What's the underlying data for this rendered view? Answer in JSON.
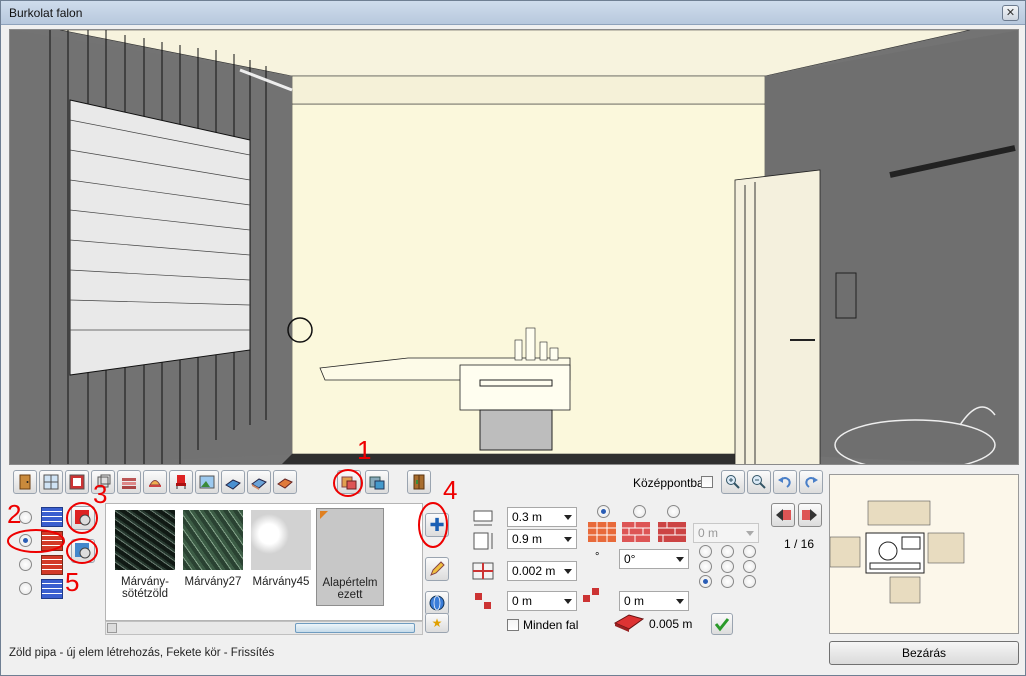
{
  "window": {
    "title": "Burkolat falon",
    "close_glyph": "✕"
  },
  "toolbar": {
    "center_label": "Középpontba",
    "buttons": [
      "door-icon",
      "window-icon",
      "frame-icon",
      "box-icon",
      "stairs-icon",
      "lamp-icon",
      "chair-icon",
      "picture-icon",
      "floor-tile-icon",
      "wall-tile-icon",
      "tile-paint-icon",
      "tile-layer-icon",
      "tile-grid-icon",
      "cabinet-icon",
      "zoom-in-icon",
      "zoom-out-icon",
      "undo-icon",
      "redo-icon"
    ]
  },
  "library": {
    "items": [
      {
        "label": "Márvány-\nsötétzöld",
        "color": "#1d2a24"
      },
      {
        "label": "Márvány27",
        "color": "#3b5a44"
      },
      {
        "label": "Márvány45",
        "color": "#d9d9d9"
      },
      {
        "label": "Alapértelm\nezett",
        "color": "#c7c7c7"
      }
    ]
  },
  "properties": {
    "width": "0.3 m",
    "height": "0.9 m",
    "joint": "0.002 m",
    "angle": "0°",
    "offset_x": "0 m",
    "offset_y": "0 m",
    "disabled_value": "0 m",
    "thickness": "0.005 m",
    "all_walls": "Minden fal",
    "degree_symbol": "°"
  },
  "pager": {
    "text": "1 / 16"
  },
  "close_button": "Bezárás",
  "status": "Zöld pipa - új elem létrehozás, Fekete kör - Frissítés",
  "annotations": [
    "1",
    "2",
    "3",
    "4",
    "5"
  ]
}
